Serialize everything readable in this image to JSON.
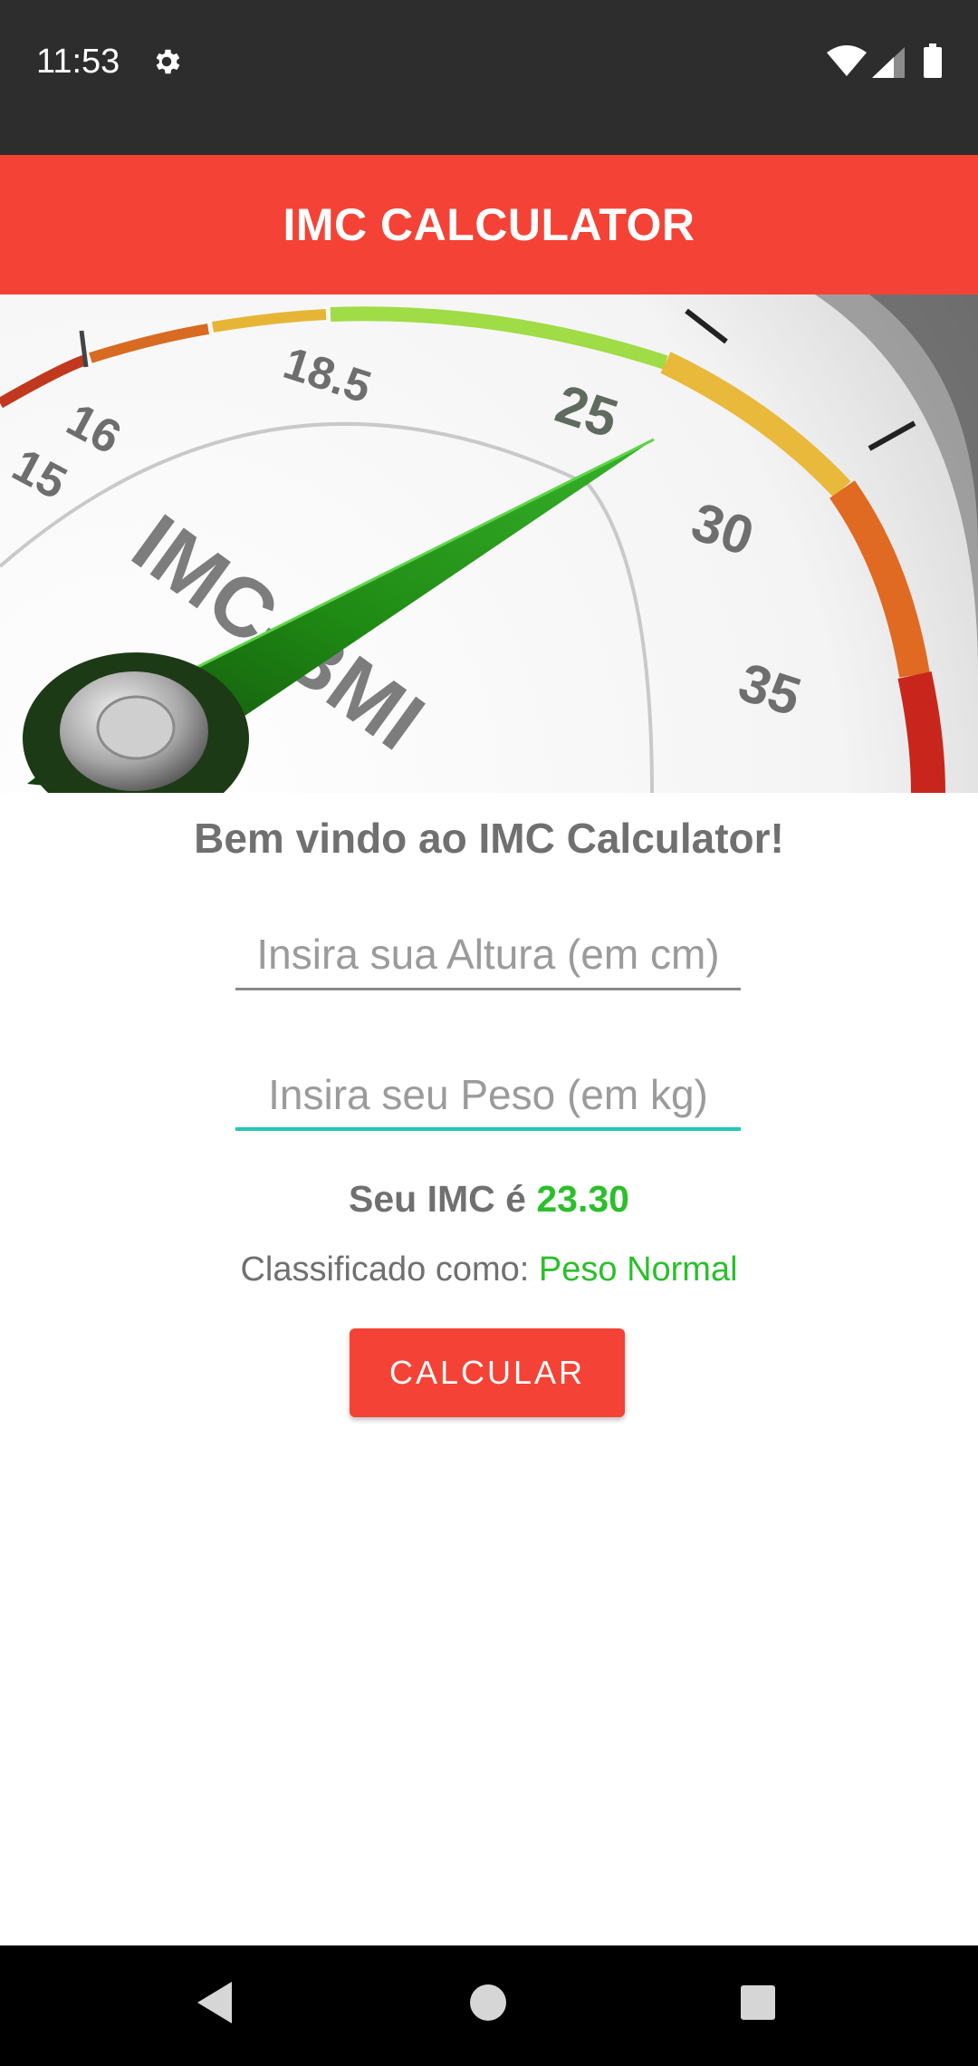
{
  "status_bar": {
    "time": "11:53",
    "icons": [
      "gear-icon",
      "wifi-icon",
      "signal-icon",
      "battery-icon"
    ]
  },
  "app_bar": {
    "title": "IMC CALCULATOR"
  },
  "banner": {
    "gauge_labels": [
      "15",
      "16",
      "18.5",
      "25",
      "30",
      "35"
    ],
    "gauge_text": "IMC-BMI"
  },
  "main": {
    "welcome": "Bem vindo ao IMC Calculator!",
    "height_field": {
      "placeholder": "Insira sua Altura (em cm)",
      "value": ""
    },
    "weight_field": {
      "placeholder": "Insira seu Peso (em kg)",
      "value": ""
    },
    "imc_prefix": "Seu IMC é",
    "imc_value": "23.30",
    "classification_prefix": "Classificado como:",
    "classification_value": "Peso Normal",
    "calculate_label": "CALCULAR"
  },
  "colors": {
    "accent": "#f44336",
    "status_bar": "#2d2d2d",
    "result_green": "#2bbf2b",
    "focus_teal": "#26c6b8"
  },
  "nav_bar": {
    "icons": [
      "back-icon",
      "home-icon",
      "recents-icon"
    ]
  }
}
